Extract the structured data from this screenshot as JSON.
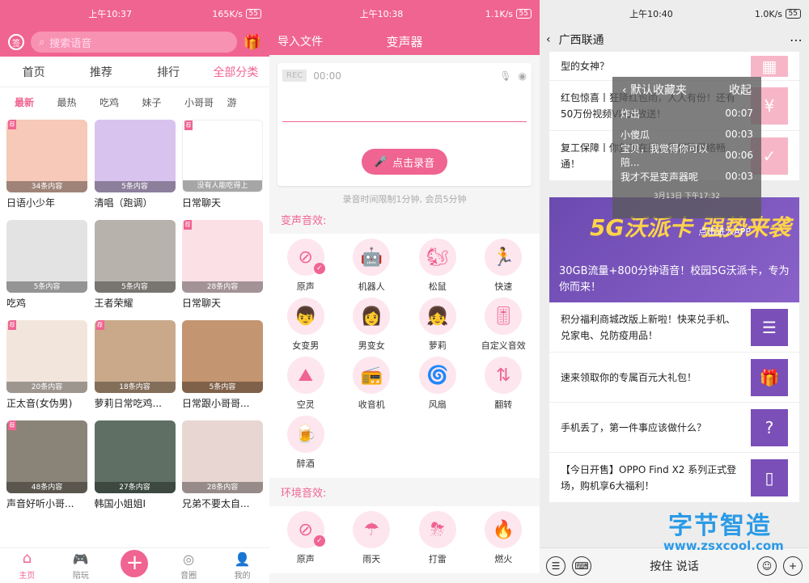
{
  "panel1": {
    "status": {
      "time": "上午10:37",
      "speed": "165K/s",
      "battery": "55"
    },
    "search_placeholder": "搜索语音",
    "top_tabs": [
      "首页",
      "推荐",
      "排行",
      "全部分类"
    ],
    "sub_tabs": [
      "最新",
      "最热",
      "吃鸡",
      "妹子",
      "小哥哥",
      "游"
    ],
    "grid": [
      {
        "count": "34条内容",
        "title": "日语小少年",
        "badge": "荐",
        "color": "#f6c9b8"
      },
      {
        "count": "5条内容",
        "title": "清唱（跑调）",
        "badge": "",
        "color": "#d8c3ee"
      },
      {
        "count": "没有人能吃得上",
        "title": "日常聊天",
        "badge": "荐",
        "color": "#ffffff"
      },
      {
        "count": "5条内容",
        "title": "吃鸡",
        "badge": "",
        "color": "#e3e3e3"
      },
      {
        "count": "5条内容",
        "title": "王者荣耀",
        "badge": "",
        "color": "#b8b2ad"
      },
      {
        "count": "28条内容",
        "title": "日常聊天",
        "badge": "荐",
        "color": "#fbe0e6"
      },
      {
        "count": "20条内容",
        "title": "正太音(女伪男)",
        "badge": "荐",
        "color": "#f2e6dc"
      },
      {
        "count": "18条内容",
        "title": "萝莉日常吃鸡...",
        "badge": "荐",
        "color": "#c9a98a"
      },
      {
        "count": "5条内容",
        "title": "日常跟小哥哥...",
        "badge": "",
        "color": "#c39570"
      },
      {
        "count": "48条内容",
        "title": "声音好听小哥...",
        "badge": "荐",
        "color": "#8a8478"
      },
      {
        "count": "27条内容",
        "title": "韩国小姐姐I",
        "badge": "",
        "color": "#5f6f64"
      },
      {
        "count": "28条内容",
        "title": "兄弟不要太自...",
        "badge": "",
        "color": "#e7d6d2"
      }
    ],
    "bottom_nav": [
      "主页",
      "陪玩",
      "",
      "音圈",
      "我的"
    ]
  },
  "panel2": {
    "status": {
      "time": "上午10:38",
      "speed": "1.1K/s",
      "battery": "55"
    },
    "import": "导入文件",
    "title": "变声器",
    "rec_tag": "REC",
    "rec_time": "00:00",
    "rec_button": "点击录音",
    "note": "录音时间限制1分钟, 会员5分钟",
    "voice_section": "变声音效:",
    "voice_fx": [
      {
        "label": "原声",
        "icon": "⊘",
        "checked": true
      },
      {
        "label": "机器人",
        "icon": "🤖",
        "checked": false
      },
      {
        "label": "松鼠",
        "icon": "🐿",
        "checked": false
      },
      {
        "label": "快速",
        "icon": "🏃",
        "checked": false
      },
      {
        "label": "女变男",
        "icon": "👦",
        "checked": false
      },
      {
        "label": "男变女",
        "icon": "👩",
        "checked": false
      },
      {
        "label": "萝莉",
        "icon": "👧",
        "checked": false
      },
      {
        "label": "自定义音效",
        "icon": "🎚",
        "checked": false
      },
      {
        "label": "空灵",
        "icon": "⛰",
        "checked": false
      },
      {
        "label": "收音机",
        "icon": "📻",
        "checked": false
      },
      {
        "label": "风扇",
        "icon": "🌀",
        "checked": false
      },
      {
        "label": "翻转",
        "icon": "⇅",
        "checked": false
      },
      {
        "label": "醉酒",
        "icon": "🍺",
        "checked": false
      }
    ],
    "env_section": "环境音效:",
    "env_fx": [
      {
        "label": "原声",
        "icon": "⊘",
        "checked": true
      },
      {
        "label": "雨天",
        "icon": "☂",
        "checked": false
      },
      {
        "label": "打雷",
        "icon": "⛈",
        "checked": false
      },
      {
        "label": "燃火",
        "icon": "🔥",
        "checked": false
      }
    ]
  },
  "panel3": {
    "status": {
      "time": "上午10:40",
      "speed": "1.0K/s",
      "battery": "55"
    },
    "title": "广西联通",
    "articles_top": [
      {
        "text": "型的女神？",
        "icon": "▦"
      },
      {
        "text": "红包惊喜丨狂降红包雨，人人有份！还有50万份视频VIP大放送！",
        "icon": "¥"
      },
      {
        "text": "复工保障丨你复工在岗，我保障网络畅通！",
        "icon": "✓"
      }
    ],
    "banner_big": "5G沃派卡 强势来袭",
    "banner_text": "30GB流量+800分钟语音！校园5G沃派卡，专为你而来！",
    "banner_enter": "点击进入APP",
    "articles": [
      {
        "text": "积分福利商城改版上新啦！快来兑手机、兑家电、兑防疫用品！",
        "icon": "☰"
      },
      {
        "text": "速来领取你的专属百元大礼包！",
        "icon": "🎁"
      },
      {
        "text": "手机丢了，第一件事应该做什么？",
        "icon": "?"
      },
      {
        "text": "【今日开售】OPPO Find X2 系列正式登场，购机享6大福利！",
        "icon": "▯"
      }
    ],
    "overlay": {
      "title": "默认收藏夹",
      "collapse": "收起",
      "rows": [
        {
          "name": "炸出",
          "time": "00:07"
        },
        {
          "name": "小傻瓜",
          "time": "00:03"
        },
        {
          "name": "宝贝，我觉得你可以陪...",
          "time": "00:06"
        },
        {
          "name": "我才不是变声器呢",
          "time": "00:03"
        }
      ],
      "date": "3月13日 下午17:32"
    },
    "hold_to_talk": "按住 说话",
    "watermark": "字节智造",
    "watermark_url": "www.zsxcool.com"
  }
}
